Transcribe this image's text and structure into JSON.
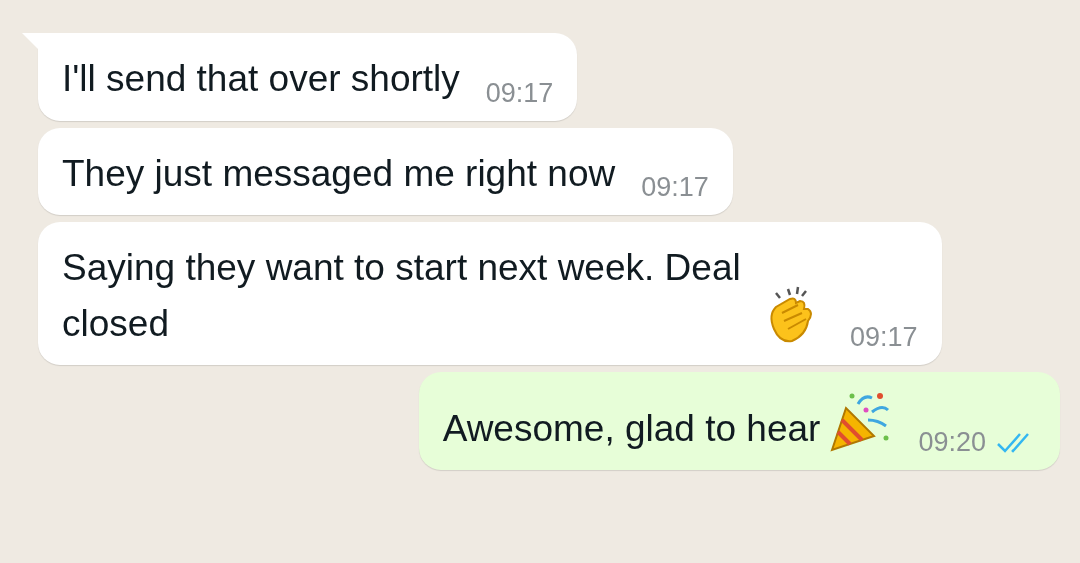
{
  "messages": [
    {
      "kind": "incoming",
      "text": "I'll send that over shortly",
      "time": "09:17",
      "tail": true
    },
    {
      "kind": "incoming",
      "text": "They just messaged me right now",
      "time": "09:17",
      "tail": false
    },
    {
      "kind": "incoming",
      "text": "Saying they want to start next week. Deal closed",
      "emoji": {
        "kind": "clap"
      },
      "time": "09:17",
      "tail": false
    },
    {
      "kind": "outgoing",
      "text": "Awesome, glad to hear",
      "emoji": {
        "kind": "party"
      },
      "time": "09:20",
      "tail": false,
      "read": true
    }
  ]
}
